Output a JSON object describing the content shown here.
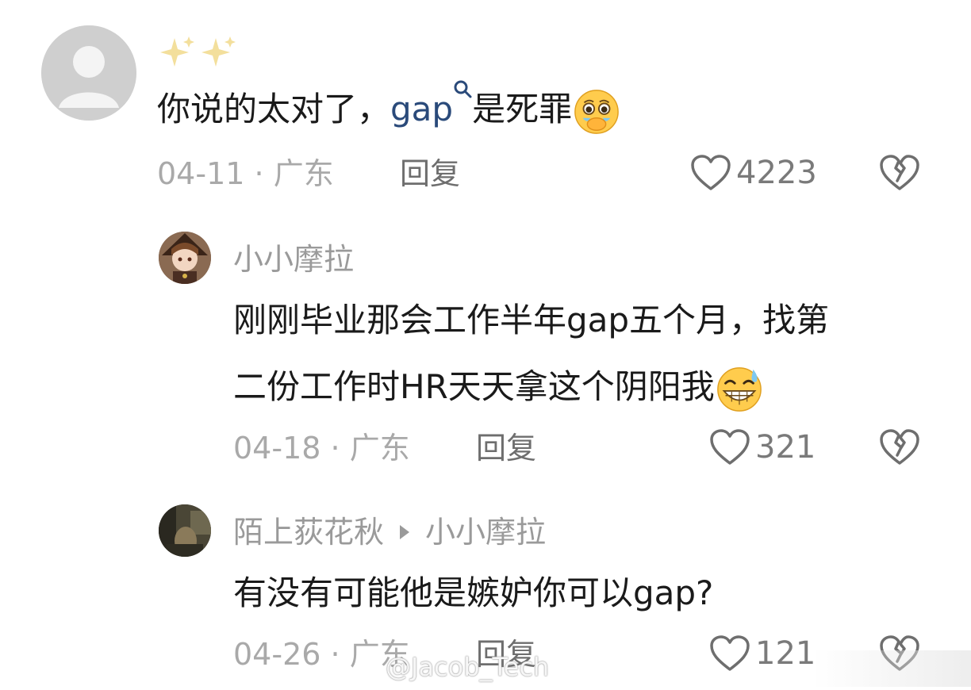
{
  "comments": {
    "main": {
      "username": "✨✨",
      "text_before": "你说的太对了，",
      "link": "gap",
      "text_after": "是死罪",
      "date": "04-11",
      "location": "广东",
      "reply_label": "回复",
      "likes": "4223"
    },
    "reply1": {
      "username": "小小摩拉",
      "text_line1": "刚刚毕业那会工作半年gap五个月，找第",
      "text_line2": "二份工作时HR天天拿这个阴阳我",
      "date": "04-18",
      "location": "广东",
      "reply_label": "回复",
      "likes": "321"
    },
    "reply2": {
      "username": "陌上荻花秋",
      "reply_to": "小小摩拉",
      "text": "有没有可能他是嫉妒你可以gap?",
      "date": "04-26",
      "location": "广东",
      "reply_label": "回复",
      "likes": "121"
    }
  },
  "meta_separator": "·",
  "watermark": "@Jacob_Tech",
  "icons": {
    "like": "heart-outline-icon",
    "dislike": "broken-heart-icon",
    "search": "search-icon",
    "reply_arrow": "triangle-right-icon"
  },
  "colors": {
    "link": "#2a4a7a",
    "meta": "#a9a9a9",
    "text": "#1a1a1a"
  }
}
